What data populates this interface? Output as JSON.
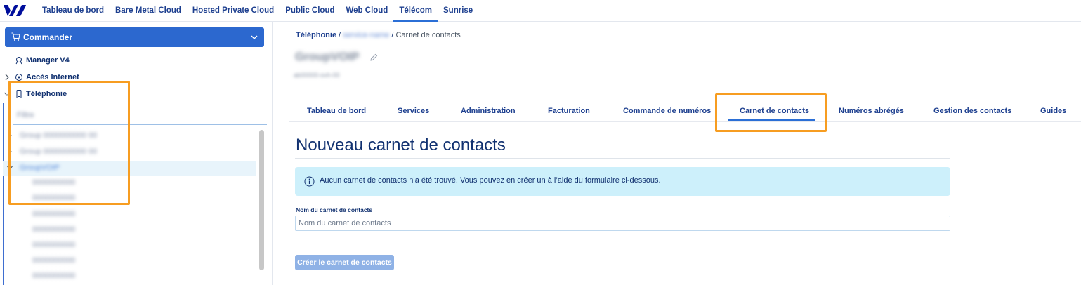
{
  "topnav": {
    "items": [
      {
        "label": "Tableau de bord"
      },
      {
        "label": "Bare Metal Cloud"
      },
      {
        "label": "Hosted Private Cloud"
      },
      {
        "label": "Public Cloud"
      },
      {
        "label": "Web Cloud"
      },
      {
        "label": "Télécom",
        "active": true
      },
      {
        "label": "Sunrise"
      }
    ]
  },
  "sidebar": {
    "order_button": "Commander",
    "items": [
      {
        "label": "Manager V4",
        "icon": "manager-icon"
      },
      {
        "label": "Accès Internet",
        "icon": "internet-icon"
      },
      {
        "label": "Téléphonie",
        "icon": "phone-icon"
      }
    ],
    "filter_text": "Filtre",
    "blurred": {
      "group_1": "Group 0000000000 00",
      "group_2": "Group 0000000000 00",
      "group_3": "GroupVOIP",
      "lines": [
        "0000000000",
        "0000000000",
        "0000000000",
        "0000000000",
        "0000000000",
        "0000000000",
        "0000000000",
        "0000000000"
      ]
    }
  },
  "breadcrumb": {
    "root": "Téléphonie",
    "separator": "/",
    "middle": "service-name",
    "current": "Carnet de contacts"
  },
  "service": {
    "title": "GroupVOIP",
    "subtitle": "ab00000-ovh-00"
  },
  "tabs": [
    {
      "label": "Tableau de bord"
    },
    {
      "label": "Services"
    },
    {
      "label": "Administration"
    },
    {
      "label": "Facturation"
    },
    {
      "label": "Commande de numéros"
    },
    {
      "label": "Carnet de contacts",
      "active": true
    },
    {
      "label": "Numéros abrégés"
    },
    {
      "label": "Gestion des contacts"
    },
    {
      "label": "Guides"
    }
  ],
  "page": {
    "title": "Nouveau carnet de contacts",
    "alert": "Aucun carnet de contacts n’a été trouvé. Vous pouvez en créer un à l’aide du formulaire ci-dessous.",
    "field_label": "Nom du carnet de contacts",
    "field_placeholder": "Nom du carnet de contacts",
    "field_value": "",
    "submit": "Créer le carnet de contacts"
  },
  "colors": {
    "brand": "#000e9c",
    "primary": "#2c68cf",
    "highlight": "#f79d21",
    "alert_bg": "#cdf0fb",
    "disabled_button": "#8fb2e6"
  }
}
